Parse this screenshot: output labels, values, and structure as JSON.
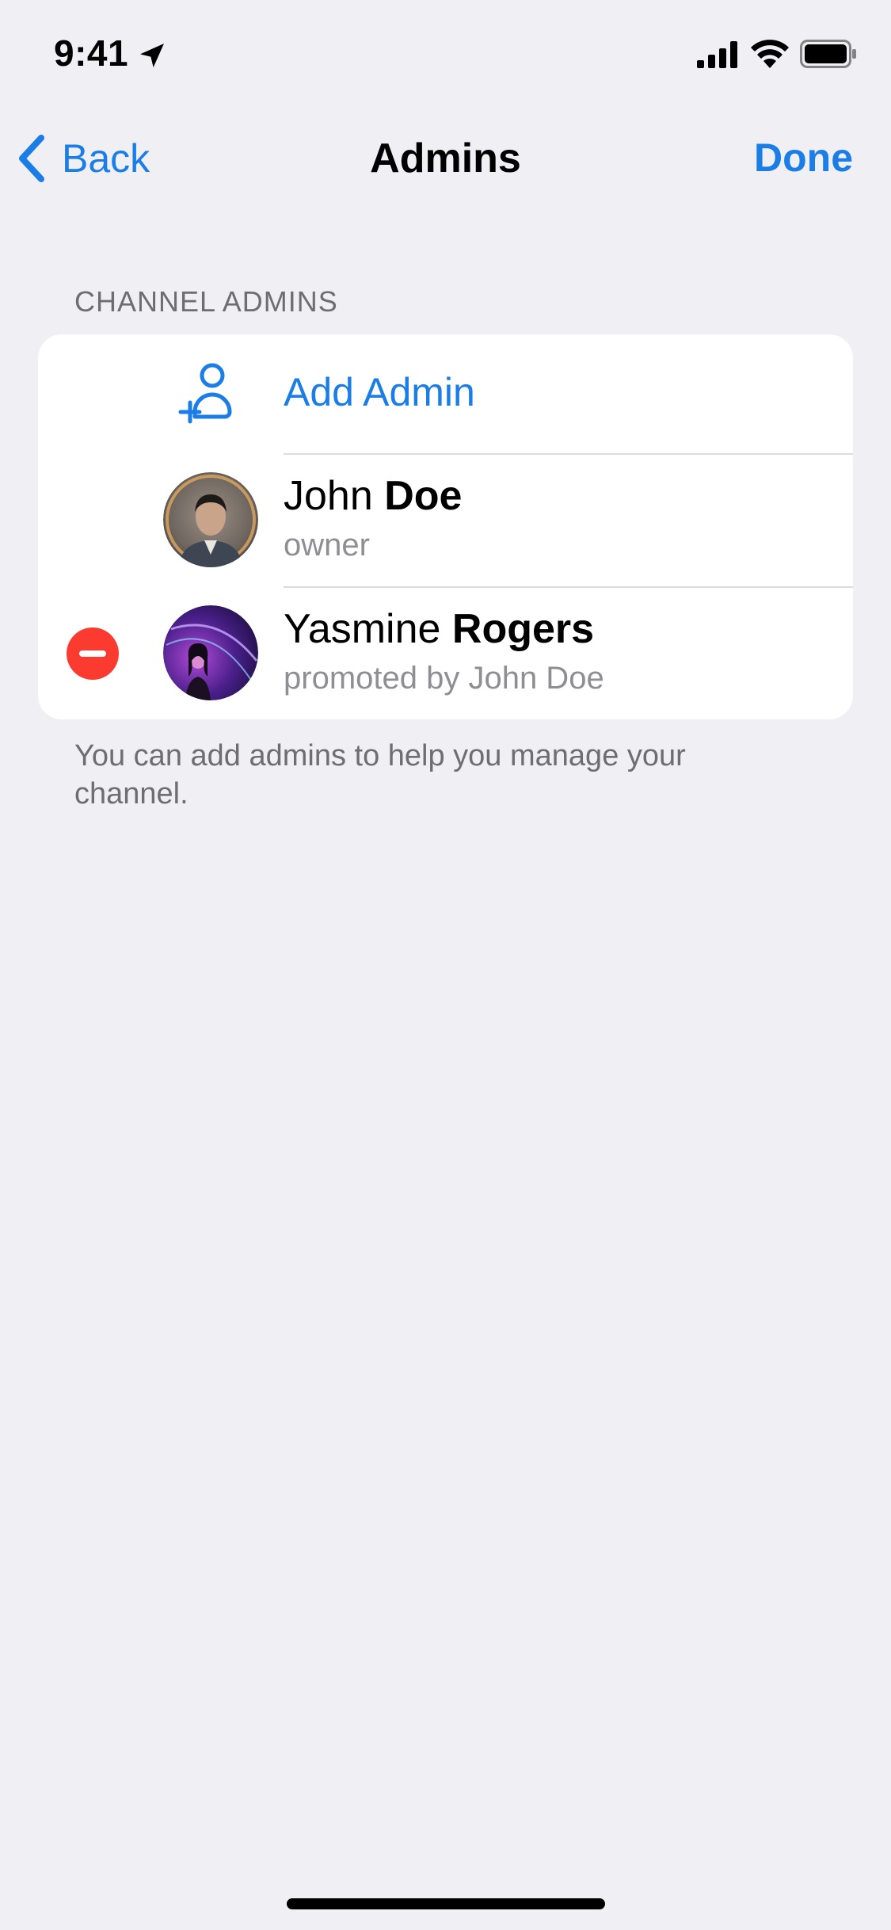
{
  "status_bar": {
    "time": "9:41",
    "icons": [
      "location-arrow-icon",
      "cellular-signal-icon",
      "wifi-icon",
      "battery-icon"
    ]
  },
  "nav": {
    "back_label": "Back",
    "title": "Admins",
    "done_label": "Done"
  },
  "section": {
    "header": "CHANNEL ADMINS",
    "add_admin_label": "Add Admin",
    "admins": [
      {
        "first_name": "John",
        "last_name": "Doe",
        "subtitle": "owner"
      },
      {
        "first_name": "Yasmine",
        "last_name": "Rogers",
        "subtitle": "promoted by John Doe"
      }
    ],
    "footer": "You can add admins to help you manage your channel."
  },
  "colors": {
    "accent": "#1a7ee6",
    "background": "#efeff4",
    "destructive": "#fb3b30",
    "secondary_text": "#8e8e93"
  }
}
